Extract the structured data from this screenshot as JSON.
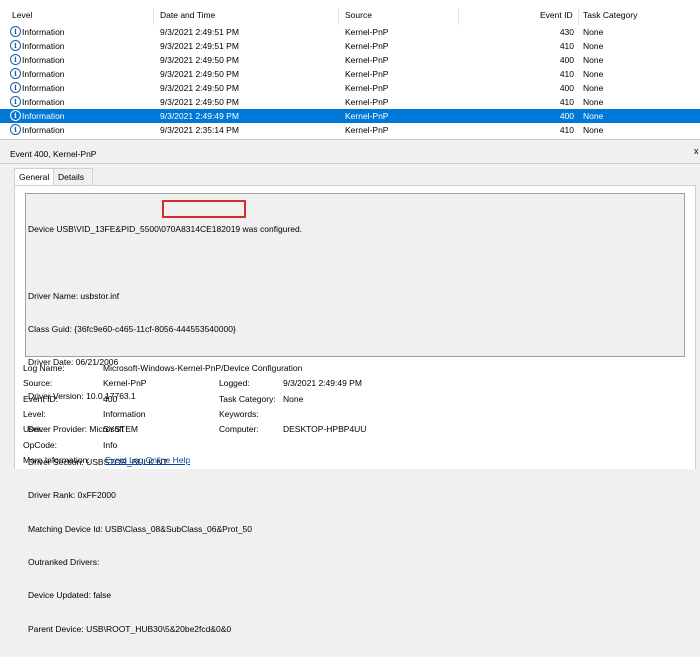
{
  "columns": {
    "level": "Level",
    "date": "Date and Time",
    "source": "Source",
    "event_id": "Event ID",
    "category": "Task Category"
  },
  "rows": [
    {
      "level": "Information",
      "date": "9/3/2021 2:49:51 PM",
      "source": "Kernel-PnP",
      "id": "430",
      "cat": "None"
    },
    {
      "level": "Information",
      "date": "9/3/2021 2:49:51 PM",
      "source": "Kernel-PnP",
      "id": "410",
      "cat": "None"
    },
    {
      "level": "Information",
      "date": "9/3/2021 2:49:50 PM",
      "source": "Kernel-PnP",
      "id": "400",
      "cat": "None"
    },
    {
      "level": "Information",
      "date": "9/3/2021 2:49:50 PM",
      "source": "Kernel-PnP",
      "id": "410",
      "cat": "None"
    },
    {
      "level": "Information",
      "date": "9/3/2021 2:49:50 PM",
      "source": "Kernel-PnP",
      "id": "400",
      "cat": "None"
    },
    {
      "level": "Information",
      "date": "9/3/2021 2:49:50 PM",
      "source": "Kernel-PnP",
      "id": "410",
      "cat": "None"
    },
    {
      "level": "Information",
      "date": "9/3/2021 2:49:49 PM",
      "source": "Kernel-PnP",
      "id": "400",
      "cat": "None"
    },
    {
      "level": "Information",
      "date": "9/3/2021 2:35:14 PM",
      "source": "Kernel-PnP",
      "id": "410",
      "cat": "None"
    }
  ],
  "detail": {
    "header": "Event 400, Kernel-PnP",
    "close": "x",
    "tabs": {
      "general": "General",
      "details": "Details"
    },
    "message": [
      "Device USB\\VID_13FE&PID_5500\\070A8314CE182019 was configured.",
      "",
      "Driver Name: usbstor.inf",
      "Class Guid: {36fc9e60-c465-11cf-8056-444553540000}",
      "Driver Date: 06/21/2006",
      "Driver Version: 10.0.17763.1",
      "Driver Provider: Microsoft",
      "Driver Section: USBSTOR_BULK.NT",
      "Driver Rank: 0xFF2000",
      "Matching Device Id: USB\\Class_08&SubClass_06&Prot_50",
      "Outranked Drivers:",
      "Device Updated: false",
      "Parent Device: USB\\ROOT_HUB30\\5&20be2fcd&0&0"
    ],
    "props": {
      "log_name_label": "Log Name:",
      "log_name": "Microsoft-Windows-Kernel-PnP/Device Configuration",
      "source_label": "Source:",
      "source": "Kernel-PnP",
      "logged_label": "Logged:",
      "logged": "9/3/2021 2:49:49 PM",
      "event_id_label": "Event ID:",
      "event_id": "400",
      "task_cat_label": "Task Category:",
      "task_cat": "None",
      "level_label": "Level:",
      "level": "Information",
      "keywords_label": "Keywords:",
      "user_label": "User:",
      "user": "SYSTEM",
      "computer_label": "Computer:",
      "computer": "DESKTOP-HPBP4UU",
      "opcode_label": "OpCode:",
      "opcode": "Info",
      "more_info_label": "More Information:",
      "more_info_link": "Event Log Online Help"
    }
  }
}
